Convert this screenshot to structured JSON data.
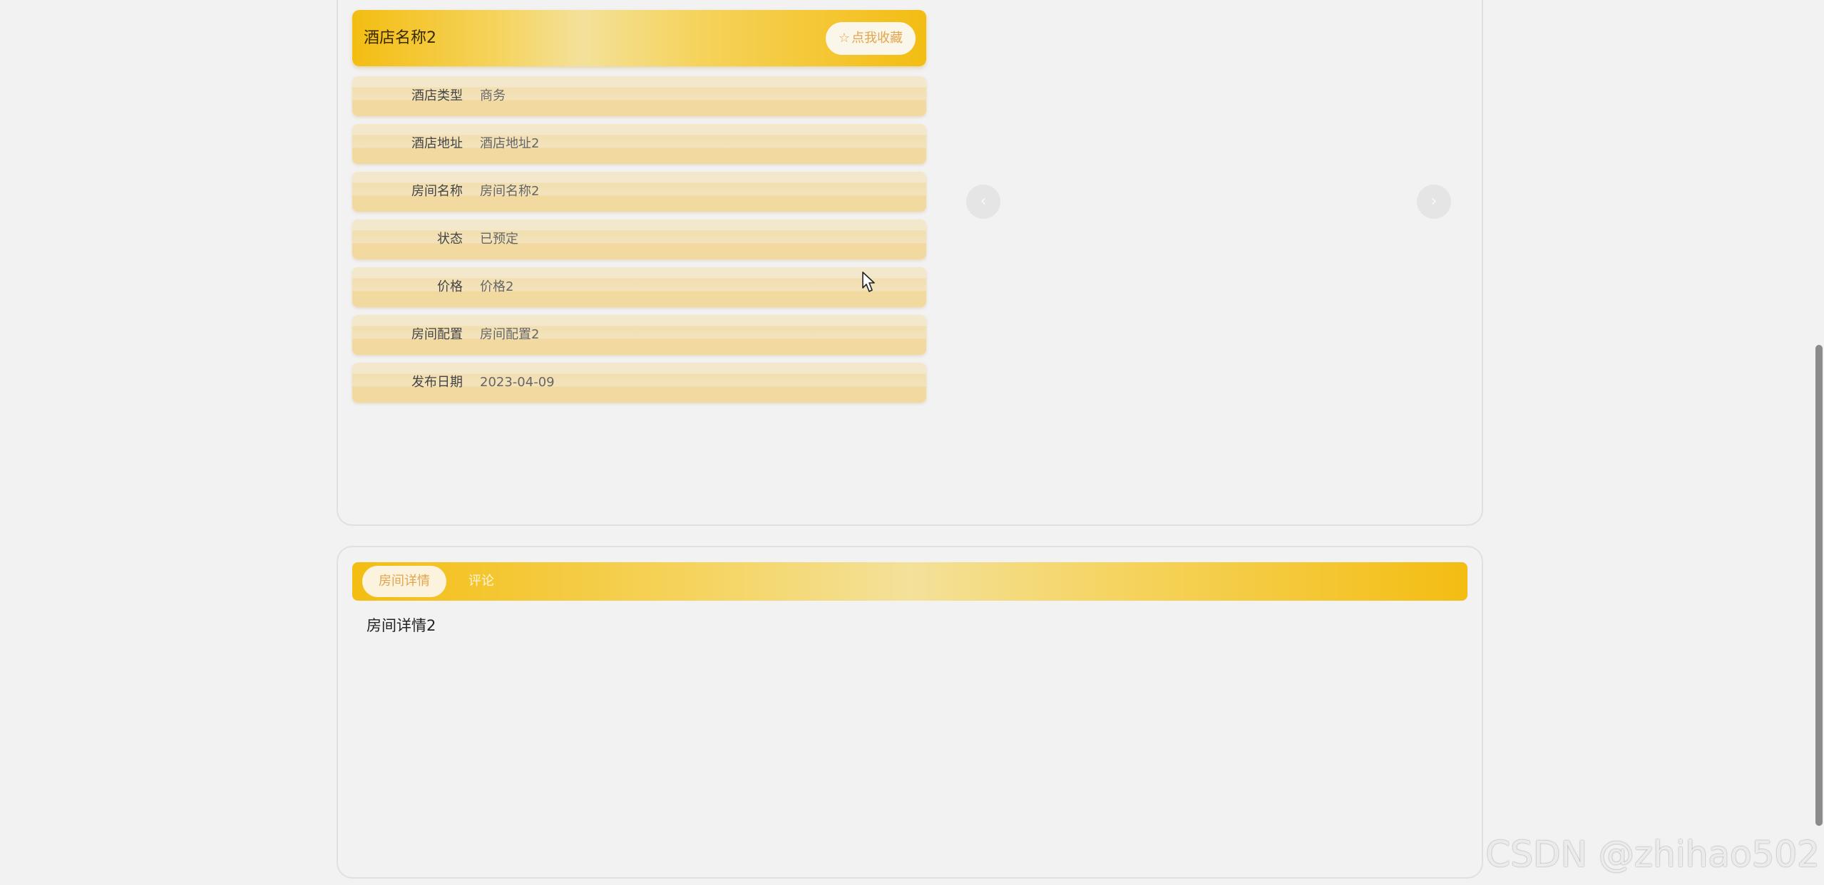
{
  "detail": {
    "hotel_name": "酒店名称2",
    "favorite_star": "☆",
    "favorite_label": "点我收藏",
    "rows": [
      {
        "label": "酒店类型",
        "value": "商务"
      },
      {
        "label": "酒店地址",
        "value": "酒店地址2"
      },
      {
        "label": "房间名称",
        "value": "房间名称2"
      },
      {
        "label": "状态",
        "value": "已预定"
      },
      {
        "label": "价格",
        "value": "价格2"
      },
      {
        "label": "房间配置",
        "value": "房间配置2"
      },
      {
        "label": "发布日期",
        "value": "2023-04-09"
      }
    ]
  },
  "carousel": {
    "prev_icon": "‹",
    "next_icon": "›"
  },
  "tabs": {
    "items": [
      {
        "label": "房间详情",
        "active": true
      },
      {
        "label": "评论",
        "active": false
      }
    ],
    "content": "房间详情2"
  },
  "watermark": "CSDN @zhihao502",
  "colors": {
    "accent_gold": "#f3bd12",
    "accent_light": "#f4e19a",
    "favorite_text": "#e3a54b",
    "row_bg": "#f2dfb0",
    "page_bg": "#f3f2f2"
  }
}
